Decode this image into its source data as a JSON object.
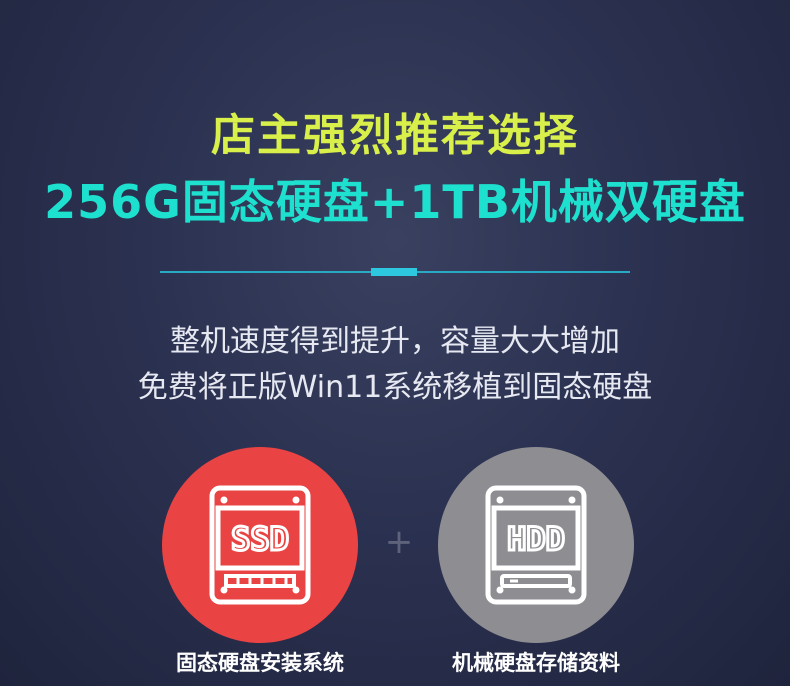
{
  "headline": {
    "line1": "店主强烈推荐选择",
    "line2": "256G固态硬盘+1TB机械双硬盘"
  },
  "subtitle": {
    "line1": "整机速度得到提升，容量大大增加",
    "line2": "免费将正版Win11系统移植到固态硬盘"
  },
  "ssd": {
    "icon_text": "SSD",
    "caption": "固态硬盘安装系统",
    "color": "#e94343"
  },
  "hdd": {
    "icon_text": "HDD",
    "caption": "机械硬盘存储资料",
    "color": "#8e8d92"
  },
  "plus_symbol": "+",
  "colors": {
    "headline1": "#d9f04a",
    "headline2": "#1ee0cf",
    "divider": "#2ec7e0"
  }
}
